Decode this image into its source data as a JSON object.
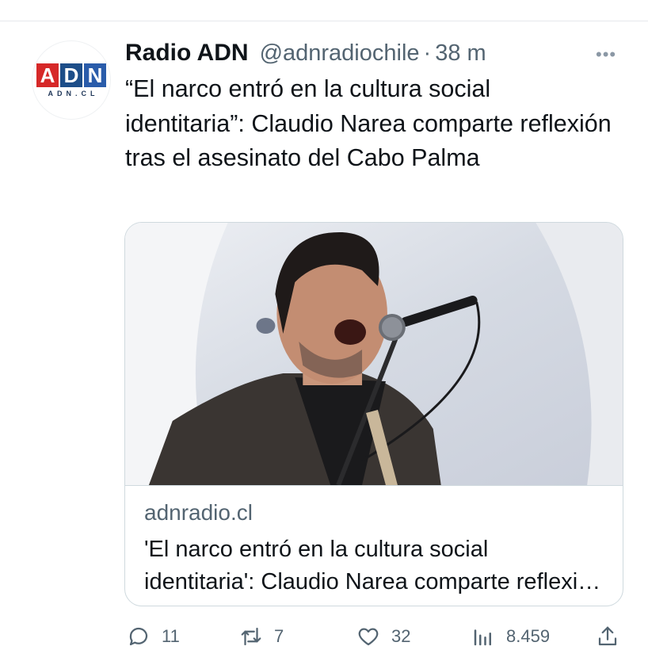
{
  "tweet": {
    "author_name": "Radio ADN",
    "handle": "@adnradiochile",
    "separator": "·",
    "time": "38 m",
    "more_label": "•••",
    "text": "“El narco entró en la cultura social identitaria”: Claudio Narea comparte reflexión tras el asesinato del Cabo Palma"
  },
  "avatar": {
    "logo_letters": [
      "A",
      "D",
      "N"
    ],
    "logo_colors": [
      "#d62828",
      "#1d4e89",
      "#2a5caa"
    ],
    "logo_subtext": "ADN.CL"
  },
  "card": {
    "domain": "adnradio.cl",
    "title": "'El narco entró en la cultura social identitaria': Claudio Narea comparte reflexión tras el asesinato del Cabo Palma"
  },
  "actions": {
    "reply_count": "11",
    "retweet_count": "7",
    "like_count": "32",
    "views_count": "8.459"
  },
  "colors": {
    "text_primary": "#0f1419",
    "text_secondary": "#536471",
    "border": "#cfd9de"
  }
}
